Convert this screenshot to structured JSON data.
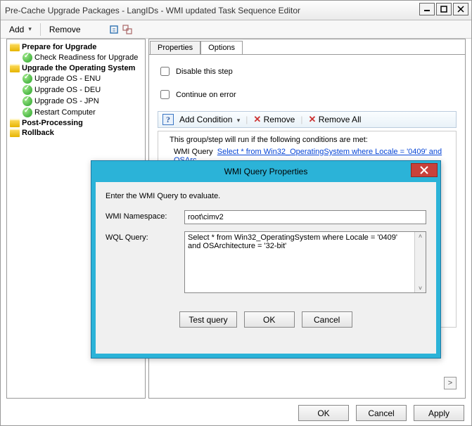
{
  "window": {
    "title": "Pre-Cache Upgrade Packages - LangIDs - WMI updated Task Sequence Editor"
  },
  "toolbar": {
    "add": "Add",
    "remove": "Remove"
  },
  "tree": {
    "n1": "Prepare for Upgrade",
    "n1a": "Check Readiness for Upgrade",
    "n2": "Upgrade the Operating System",
    "n2a": "Upgrade OS - ENU",
    "n2b": "Upgrade OS - DEU",
    "n2c": "Upgrade OS - JPN",
    "n2d": "Restart Computer",
    "n3": "Post-Processing",
    "n4": "Rollback"
  },
  "tabs": {
    "properties": "Properties",
    "options": "Options"
  },
  "options": {
    "disable": "Disable this step",
    "continue": "Continue on error",
    "add_condition": "Add Condition",
    "remove": "Remove",
    "remove_all": "Remove All",
    "cond_desc": "This group/step will run if the following conditions are met:",
    "cond_type": "WMI Query",
    "cond_text": "Select * from Win32_OperatingSystem where Locale = '0409' and OSArc"
  },
  "dialog": {
    "title": "WMI Query Properties",
    "intro": "Enter the WMI Query to evaluate.",
    "ns_label": "WMI Namespace:",
    "ns_value": "root\\cimv2",
    "wql_label": "WQL Query:",
    "wql_value": "Select * from Win32_OperatingSystem where Locale = '0409' and OSArchitecture = '32-bit'",
    "test": "Test query",
    "ok": "OK",
    "cancel": "Cancel"
  },
  "main_buttons": {
    "ok": "OK",
    "cancel": "Cancel",
    "apply": "Apply"
  }
}
